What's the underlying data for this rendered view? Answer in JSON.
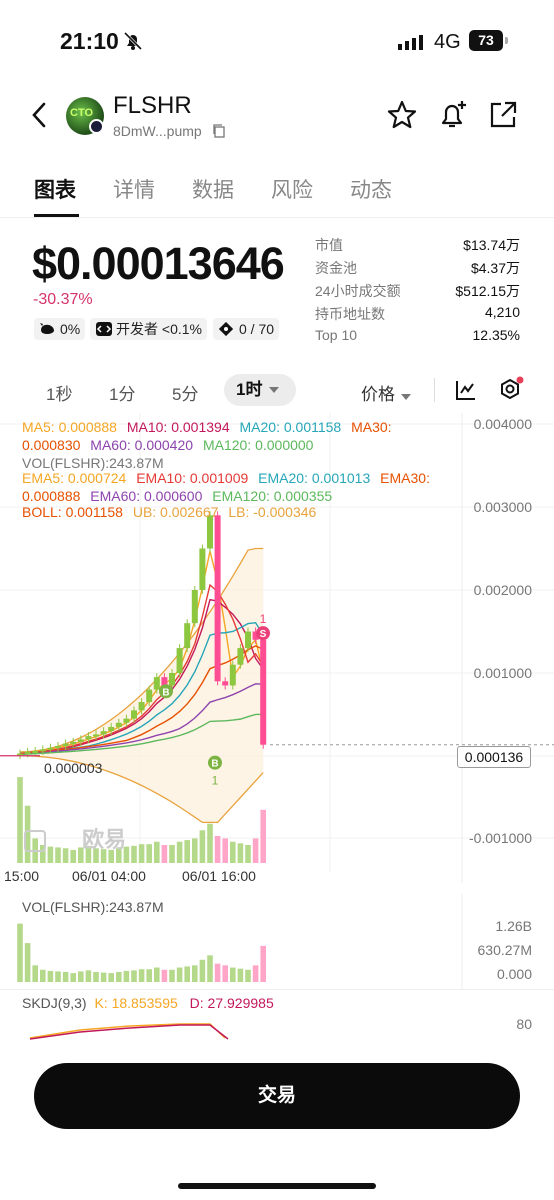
{
  "status_bar": {
    "time": "21:10",
    "network": "4G",
    "battery": "73"
  },
  "header": {
    "token_name": "FLSHR",
    "address": "8DmW...pump",
    "avatar_text": "CTO"
  },
  "tabs": [
    {
      "label": "图表",
      "active": true
    },
    {
      "label": "详情"
    },
    {
      "label": "数据"
    },
    {
      "label": "风险"
    },
    {
      "label": "动态"
    }
  ],
  "price": {
    "value": "$0.00013646",
    "change": "-30.37%",
    "chips": {
      "holders_pct": "0%",
      "dev": "开发者 <0.1%",
      "snipers": "0 / 70"
    }
  },
  "stats": [
    {
      "label": "市值",
      "value": "$13.74万"
    },
    {
      "label": "资金池",
      "value": "$4.37万"
    },
    {
      "label": "24小时成交额",
      "value": "$512.15万"
    },
    {
      "label": "持币地址数",
      "value": "4,210"
    },
    {
      "label": "Top 10",
      "value": "12.35%"
    }
  ],
  "intervals": {
    "i1": "1秒",
    "i2": "1分",
    "i3": "5分",
    "active": "1时",
    "price_select": "价格"
  },
  "indicators": {
    "ma5": "MA5: 0.000888",
    "ma10": "MA10: 0.001394",
    "ma20": "MA20: 0.001158",
    "ma30": "MA30:",
    "ma30v": "0.000830",
    "ma60": "MA60: 0.000420",
    "ma120": "MA120: 0.000000",
    "vol": "VOL(FLSHR):243.87M",
    "ema5": "EMA5: 0.000724",
    "ema10": "EMA10: 0.001009",
    "ema20": "EMA20: 0.001013",
    "ema30": "EMA30:",
    "ema30v": "0.000888",
    "ema60": "EMA60: 0.000600",
    "ema120": "EMA120: 0.000355",
    "boll": "BOLL: 0.001158",
    "ub": "UB: 0.002667",
    "lb": "LB: -0.000346"
  },
  "chart_axis": {
    "y_labels": [
      "0.004000",
      "0.003000",
      "0.002000",
      "0.001000",
      "-0.001000"
    ],
    "current_price": "0.000136",
    "low_marker": "0.000003",
    "x_labels": [
      "15:00",
      "06/01 04:00",
      "06/01 16:00"
    ],
    "watermark": "欧易",
    "marker_b": "B",
    "marker_s": "S",
    "marker_count": "1"
  },
  "volume_panel": {
    "title": "VOL(FLSHR):243.87M",
    "y_labels": [
      "1.26B",
      "630.27M",
      "0.000"
    ]
  },
  "kdj": {
    "title": "SKDJ(9,3)",
    "k": "K: 18.853595",
    "d": "D: 27.929985",
    "y_label": "80"
  },
  "colors": {
    "up": "#8dc63f",
    "down": "#ff4d94",
    "ma5": "#f5a623",
    "ma10": "#c2185b",
    "ma20": "#26a6b8",
    "ma60": "#8e44ad",
    "ma120": "#5cb85c",
    "ema10": "#e53935",
    "ema30": "#e65100",
    "boll": "#e8a33d",
    "accent": "#e8405a"
  },
  "actions": {
    "trade": "交易"
  },
  "chart_data": {
    "type": "candlestick",
    "y_range": [
      -0.0015,
      0.004
    ],
    "candles": [
      [
        1e-05,
        3e-05
      ],
      [
        3e-05,
        5e-05
      ],
      [
        5e-05,
        6e-05
      ],
      [
        6e-05,
        8e-05
      ],
      [
        8e-05,
        0.0001
      ],
      [
        0.0001,
        0.00012
      ],
      [
        0.00012,
        0.00015
      ],
      [
        0.00015,
        0.00017
      ],
      [
        0.00017,
        0.0002
      ],
      [
        0.0002,
        0.00024
      ],
      [
        0.00024,
        0.00026
      ],
      [
        0.00026,
        0.0003
      ],
      [
        0.0003,
        0.00035
      ],
      [
        0.00035,
        0.0004
      ],
      [
        0.0004,
        0.00045
      ],
      [
        0.00045,
        0.00055
      ],
      [
        0.00055,
        0.00065
      ],
      [
        0.00065,
        0.0008
      ],
      [
        0.0008,
        0.00095
      ],
      [
        0.00095,
        0.00085
      ],
      [
        0.00085,
        0.001
      ],
      [
        0.001,
        0.0013
      ],
      [
        0.0013,
        0.0016
      ],
      [
        0.0016,
        0.002
      ],
      [
        0.002,
        0.0025
      ],
      [
        0.0025,
        0.0029
      ],
      [
        0.0029,
        0.0009
      ],
      [
        0.0009,
        0.00085
      ],
      [
        0.00085,
        0.0011
      ],
      [
        0.0011,
        0.0013
      ],
      [
        0.0013,
        0.0015
      ],
      [
        0.0015,
        0.0014
      ],
      [
        0.0014,
        0.000136
      ]
    ],
    "volumes_m": [
      1050,
      700,
      300,
      220,
      200,
      190,
      180,
      160,
      190,
      210,
      180,
      170,
      160,
      180,
      200,
      210,
      230,
      230,
      260,
      220,
      220,
      260,
      280,
      300,
      400,
      480,
      330,
      300,
      260,
      240,
      220,
      300,
      650
    ]
  }
}
